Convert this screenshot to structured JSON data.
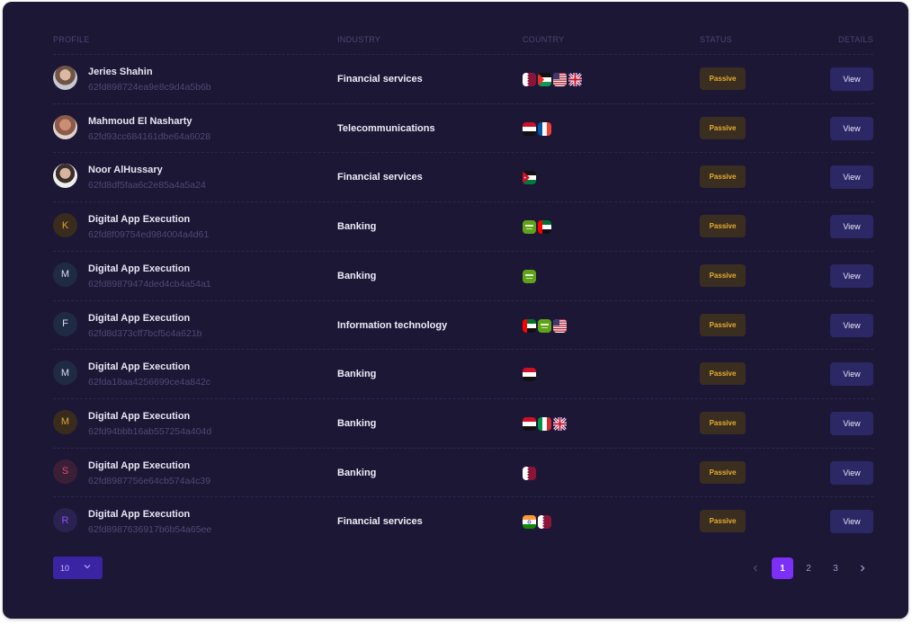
{
  "table": {
    "headers": {
      "profile": "PROFILE",
      "industry": "INDUSTRY",
      "country": "COUNTRY",
      "status": "STATUS",
      "details": "DETAILS"
    },
    "rows": [
      {
        "name": "Jeries Shahin",
        "id": "62fd898724ea9e8c9d4a5b6b",
        "industry": "Financial services",
        "flags": [
          "qatar-flag",
          "palestine-flag",
          "usa-flag",
          "uk-flag"
        ],
        "status": "Passive",
        "action": "View"
      },
      {
        "name": "Mahmoud El Nasharty",
        "id": "62fd93cc684161dbe64a6028",
        "industry": "Telecommunications",
        "flags": [
          "egypt-flag",
          "france-flag"
        ],
        "status": "Passive",
        "action": "View"
      },
      {
        "name": "Noor AlHussary",
        "id": "62fd8df5faa6c2e85a4a5a24",
        "industry": "Financial services",
        "flags": [
          "jordan-flag"
        ],
        "status": "Passive",
        "action": "View"
      },
      {
        "name": "Digital App Execution",
        "avatar_letter": "K",
        "id": "62fd8f09754ed984004a4d61",
        "industry": "Banking",
        "flags": [
          "saudi-flag",
          "uae-flag"
        ],
        "status": "Passive",
        "action": "View"
      },
      {
        "name": "Digital App Execution",
        "avatar_letter": "M",
        "id": "62fd89879474ded4cb4a54a1",
        "industry": "Banking",
        "flags": [
          "saudi-flag"
        ],
        "status": "Passive",
        "action": "View"
      },
      {
        "name": "Digital App Execution",
        "avatar_letter": "F",
        "id": "62fd8d373cff7bcf5c4a621b",
        "industry": "Information technology",
        "flags": [
          "uae-flag",
          "saudi-flag",
          "usa-flag"
        ],
        "status": "Passive",
        "action": "View"
      },
      {
        "name": "Digital App Execution",
        "avatar_letter": "M",
        "id": "62fda18aa4256699ce4a842c",
        "industry": "Banking",
        "flags": [
          "egypt-flag"
        ],
        "status": "Passive",
        "action": "View"
      },
      {
        "name": "Digital App Execution",
        "avatar_letter": "M",
        "id": "62fd94bbb16ab557254a404d",
        "industry": "Banking",
        "flags": [
          "egypt-flag",
          "italy-flag",
          "uk-flag"
        ],
        "status": "Passive",
        "action": "View"
      },
      {
        "name": "Digital App Execution",
        "avatar_letter": "S",
        "id": "62fd8987756e64cb574a4c39",
        "industry": "Banking",
        "flags": [
          "qatar-flag"
        ],
        "status": "Passive",
        "action": "View"
      },
      {
        "name": "Digital App Execution",
        "avatar_letter": "R",
        "id": "62fd8987636917b6b54a65ee",
        "industry": "Financial services",
        "flags": [
          "india-flag",
          "qatar-flag"
        ],
        "status": "Passive",
        "action": "View"
      }
    ]
  },
  "footer": {
    "page_size": "10",
    "pages": [
      "1",
      "2",
      "3"
    ],
    "current_page": "1"
  },
  "colors": {
    "background": "#1d1736",
    "passive_badge_bg": "#3a2e21",
    "passive_badge_text": "#e7ad2f",
    "view_button": "#2c2866",
    "active_page": "#7b2ff7"
  }
}
